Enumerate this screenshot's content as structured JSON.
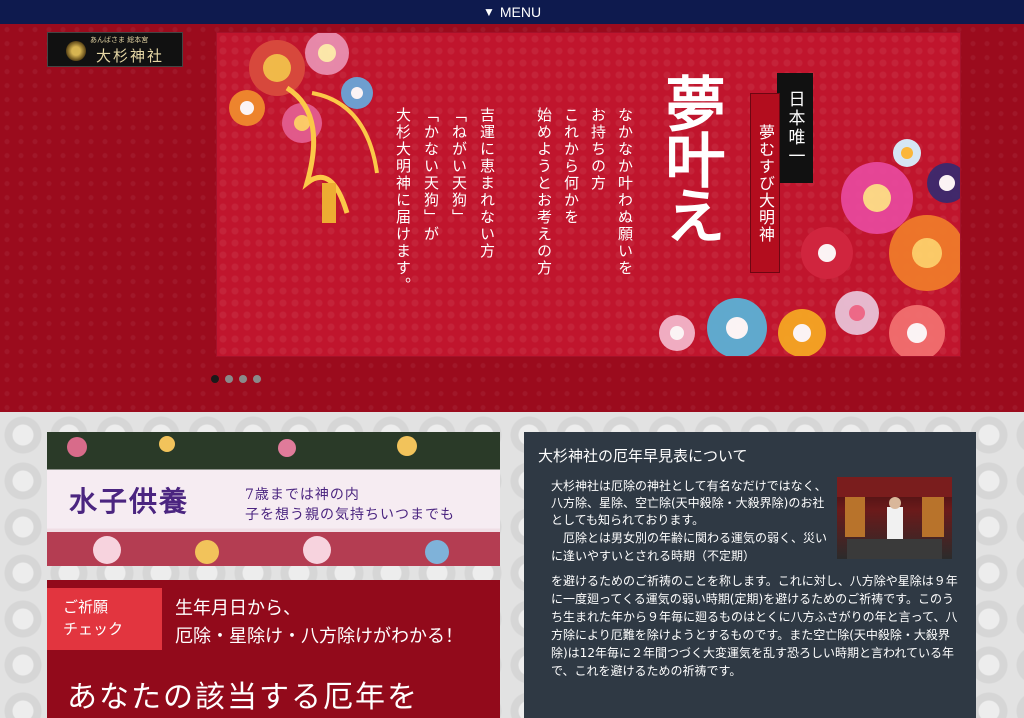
{
  "menu": {
    "label": "MENU"
  },
  "logo": {
    "subtitle": "あんばさま 総本宮",
    "name": "大杉神社"
  },
  "hero": {
    "poem": [
      "なかなか叶わぬ願いを",
      "お持ちの方",
      "これから何かを",
      "始めようとお考えの方",
      "吉運に恵まれない方",
      "「ねがい天狗」",
      "「かない天狗」が",
      "大杉大明神に届けます。"
    ],
    "calligraphy": "夢叶え",
    "badge_black": "日本唯一",
    "badge_red": "夢むすび大明神",
    "active_slide": 0,
    "slide_count": 4
  },
  "mizuko": {
    "title": "水子供養",
    "subtitle_line1": "7歳までは神の内",
    "subtitle_line2": "子を想う親の気持ちいつまでも"
  },
  "check": {
    "badge_line1": "ご祈願",
    "badge_line2": "チェック",
    "line1": "生年月日から、",
    "line2": "厄除・星除け・八方除けがわかる！",
    "big": "あなたの該当する厄年を"
  },
  "info": {
    "title": "大杉神社の厄年早見表について",
    "para1": "大杉神社は厄除の神社として有名なだけではなく、八方除、星除、空亡除(天中殺除・大殺界除)のお社としても知られております。",
    "para2": "厄除とは男女別の年齢に関わる運気の弱く、災いに逢いやすいとされる時期（不定期）",
    "para3": "を避けるためのご祈祷のことを称します。これに対し、八方除や星除は９年に一度廻ってくる運気の弱い時期(定期)を避けるためのご祈祷です。このうち生まれた年から９年毎に廻るものはとくに八方ふさがりの年と言って、八方除により厄難を除けようとするものです。また空亡除(天中殺除・大殺界除)は12年毎に２年間つづく大変運気を乱す恐ろしい時期と言われている年で、これを避けるための祈祷です。"
  }
}
